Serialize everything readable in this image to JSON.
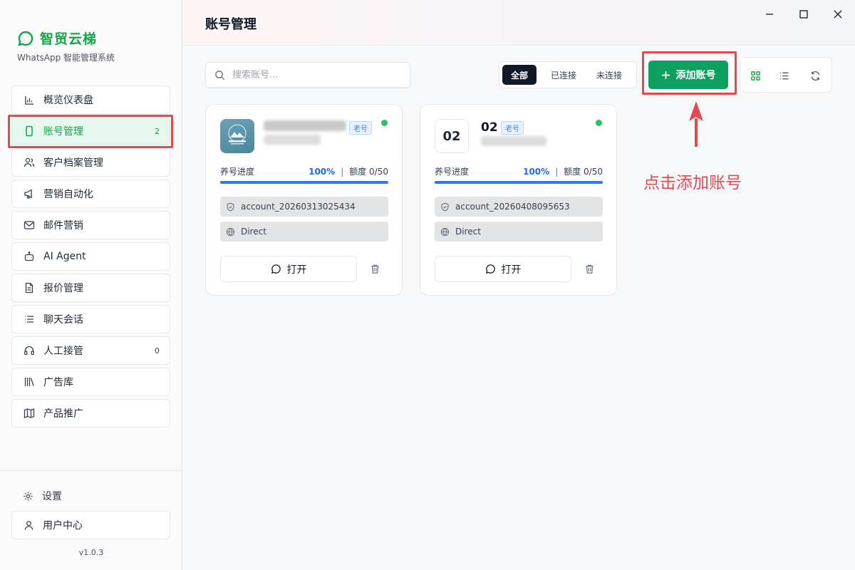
{
  "app": {
    "brand_name": "智贸云梯",
    "brand_sub": "WhatsApp 智能管理系统",
    "version": "v1.0.3",
    "accent": "#16a34a",
    "primary_button_color": "#0d9f5f",
    "highlight_color": "#e5484d"
  },
  "sidebar": {
    "items": [
      {
        "label": "概览仪表盘",
        "icon": "bar-chart-icon",
        "badge": ""
      },
      {
        "label": "账号管理",
        "icon": "phone-icon",
        "badge": "2",
        "active": true
      },
      {
        "label": "客户档案管理",
        "icon": "users-icon",
        "badge": ""
      },
      {
        "label": "营销自动化",
        "icon": "megaphone-icon",
        "badge": ""
      },
      {
        "label": "邮件营销",
        "icon": "mail-icon",
        "badge": ""
      },
      {
        "label": "AI Agent",
        "icon": "bot-icon",
        "badge": ""
      },
      {
        "label": "报价管理",
        "icon": "document-icon",
        "badge": ""
      },
      {
        "label": "聊天会话",
        "icon": "list-icon",
        "badge": ""
      },
      {
        "label": "人工接管",
        "icon": "headset-icon",
        "badge": "0"
      },
      {
        "label": "广告库",
        "icon": "library-icon",
        "badge": ""
      },
      {
        "label": "产品推广",
        "icon": "map-icon",
        "badge": ""
      }
    ],
    "settings_label": "设置",
    "user_center_label": "用户中心"
  },
  "header": {
    "title": "账号管理"
  },
  "toolbar": {
    "search_placeholder": "搜索账号...",
    "filters": [
      "全部",
      "已连接",
      "未连接"
    ],
    "active_filter": "全部",
    "add_label": "添加账号",
    "view_modes": [
      "grid-icon",
      "list-icon",
      "refresh-icon"
    ]
  },
  "accounts": [
    {
      "avatar_text": "",
      "name": "",
      "tag": "老号",
      "status": "online",
      "progress_label": "养号进度",
      "progress_pct": "100%",
      "progress_value": 1.0,
      "quota": "额度 0/50",
      "account_id": "account_20260313025434",
      "proxy": "Direct",
      "open_label": "打开"
    },
    {
      "avatar_text": "02",
      "name": "02",
      "tag": "老号",
      "status": "online",
      "progress_label": "养号进度",
      "progress_pct": "100%",
      "progress_value": 1.0,
      "quota": "额度 0/50",
      "account_id": "account_20260408095653",
      "proxy": "Direct",
      "open_label": "打开"
    }
  ],
  "annotation": {
    "text": "点击添加账号"
  }
}
